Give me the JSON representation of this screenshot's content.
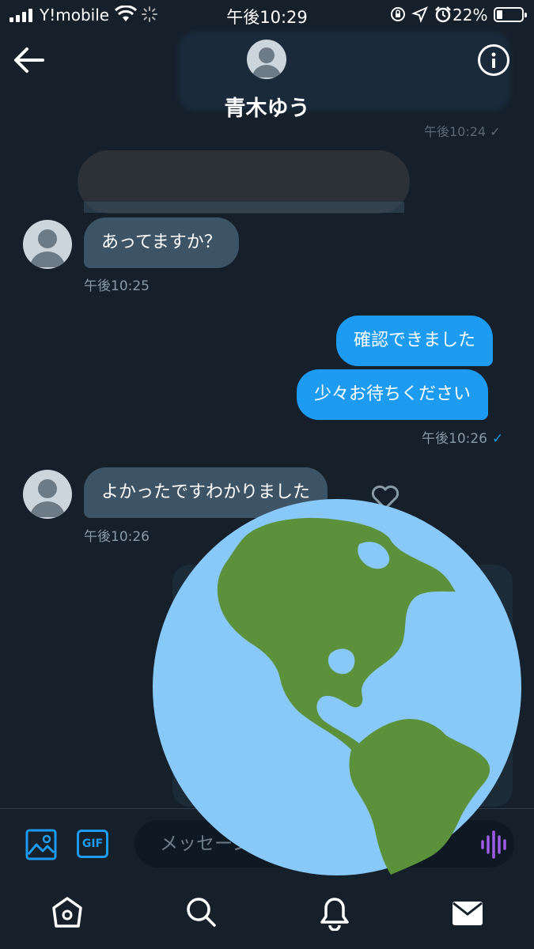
{
  "status_bar": {
    "carrier": "Y!mobile",
    "time": "午後10:29",
    "battery": "22%"
  },
  "header": {
    "contact_name": "青木ゆう",
    "prev_timestamp": "午後10:24 ✓"
  },
  "messages": [
    {
      "direction": "in",
      "text": "あってますか？",
      "time": "午後10:25"
    },
    {
      "direction": "out",
      "text": "確認できました"
    },
    {
      "direction": "out",
      "text": "少々お待ちください",
      "time": "午後10:26",
      "check": "✓"
    },
    {
      "direction": "in",
      "text": "よかったですわかりました",
      "time": "午後10:26"
    }
  ],
  "composer": {
    "gif_label": "GIF",
    "placeholder": "メッセージを作成"
  },
  "tabs": [
    "home-icon",
    "search-icon",
    "notifications-icon",
    "messages-icon"
  ],
  "colors": {
    "background": "#15202b",
    "accent": "#1d9bf0",
    "incoming_bubble": "#3d5466",
    "globe_ocean": "#88c9f9",
    "globe_land": "#5c913b"
  }
}
